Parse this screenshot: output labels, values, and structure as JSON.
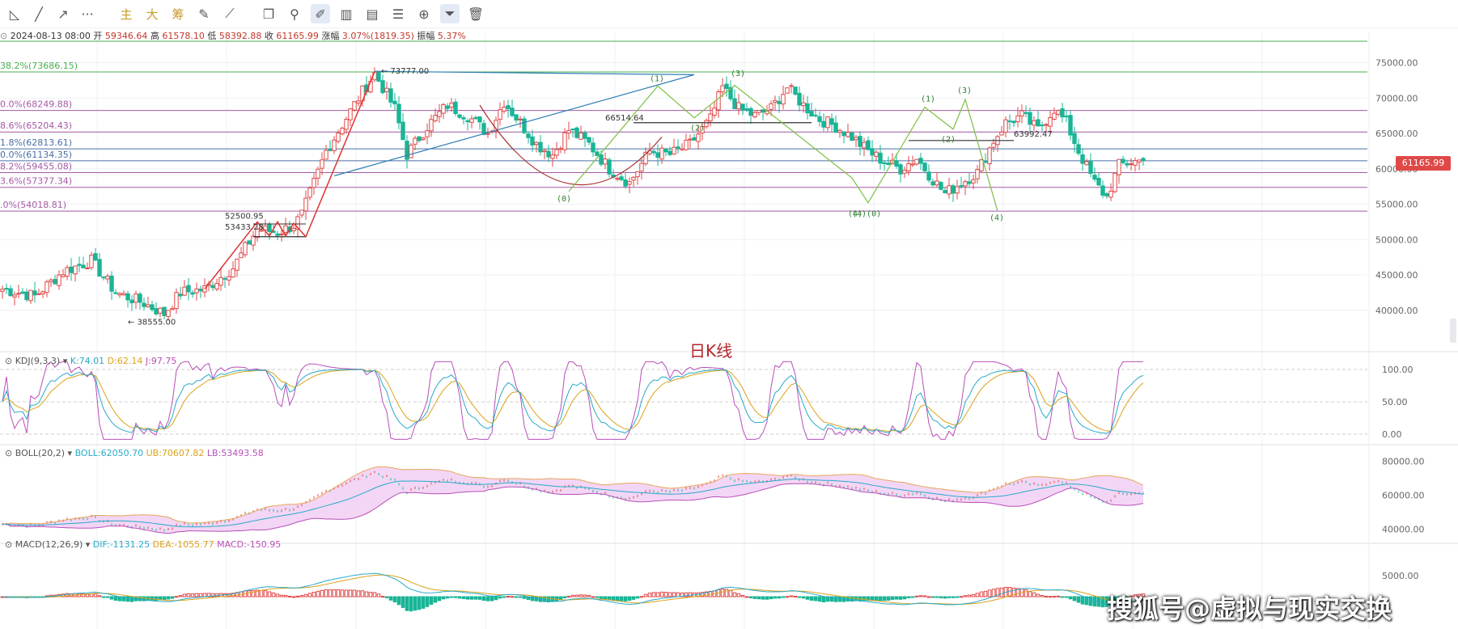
{
  "toolbar": {
    "items": [
      {
        "name": "line-segment-icon",
        "glyph": "◺"
      },
      {
        "name": "trend-line-icon",
        "glyph": "╱"
      },
      {
        "name": "ray-icon",
        "glyph": "↗"
      },
      {
        "name": "more-icon",
        "glyph": "···"
      },
      {
        "name": "main-indicator-button",
        "glyph": "主"
      },
      {
        "name": "large-order-button",
        "glyph": "大"
      },
      {
        "name": "chip-distribution-button",
        "glyph": "筹"
      },
      {
        "name": "edit-icon",
        "glyph": "✎"
      },
      {
        "name": "ruler-icon",
        "glyph": "⟋"
      },
      {
        "name": "copy-icon",
        "glyph": "❐"
      },
      {
        "name": "link-icon",
        "glyph": "⚲"
      },
      {
        "name": "draw-pen-icon",
        "glyph": "✐"
      },
      {
        "name": "candlestick-icon",
        "glyph": "▥"
      },
      {
        "name": "clipboard-icon",
        "glyph": "▤"
      },
      {
        "name": "note-icon",
        "glyph": "☰"
      },
      {
        "name": "pin-icon",
        "glyph": "⊕"
      },
      {
        "name": "filter-icon",
        "glyph": "⏷"
      },
      {
        "name": "trash-icon",
        "glyph": "🗑"
      }
    ]
  },
  "infobar": {
    "date": "2024-08-13 08:00",
    "open_label": "开",
    "open": "59346.64",
    "high_label": "高",
    "high": "61578.10",
    "low_label": "低",
    "low": "58392.88",
    "close_label": "收",
    "close": "61165.99",
    "change_label": "涨幅",
    "change": "3.07%(1819.35)",
    "amp_label": "振幅",
    "amp": "5.37%"
  },
  "chart_title": "日K线",
  "watermark": "搜狐号@虚拟与现实交换",
  "last_price": "61165.99",
  "colors": {
    "up": "#e04848",
    "down": "#19b596",
    "grid": "#eef0f3",
    "fib_green": "#4caf50",
    "fib_purple": "#a45aa4",
    "wave_green": "#7bc043",
    "trend_blue": "#2f7fb5"
  },
  "chart_data": [
    {
      "type": "candlestick",
      "name": "daily-kline",
      "title": "日K线",
      "ylim": [
        37000,
        77000
      ],
      "y_ticks": [
        "75000.00",
        "70000.00",
        "65000.00",
        "60000.00",
        "55000.00",
        "50000.00",
        "45000.00",
        "40000.00"
      ],
      "y_tick_values": [
        75000,
        70000,
        65000,
        60000,
        55000,
        50000,
        45000,
        40000
      ],
      "fib_levels": [
        {
          "label": "38.2%(73686.15)",
          "value": 73686.15,
          "color": "#4caf50"
        },
        {
          "label": "0.0%(68249.88)",
          "value": 68249.88,
          "color": "#a45aa4"
        },
        {
          "label": "8.6%(65204.43)",
          "value": 65204.43,
          "color": "#a45aa4"
        },
        {
          "label": "1.8%(62813.61)",
          "value": 62813.61,
          "color": "#4a6fa5"
        },
        {
          "label": "0.0%(61134.35)",
          "value": 61134.35,
          "color": "#4a6fa5"
        },
        {
          "label": "8.2%(59455.08)",
          "value": 59455.08,
          "color": "#a45aa4"
        },
        {
          "label": "3.6%(57377.34)",
          "value": 57377.34,
          "color": "#a45aa4"
        },
        {
          "label": ".0%(54018.81)",
          "value": 54018.81,
          "color": "#a45aa4"
        }
      ],
      "annotations": [
        "73777.00",
        "66514.64",
        "63992.47",
        "52500.95",
        "53433.28",
        "38555.00"
      ],
      "wave_labels": [
        "(1)",
        "(2)",
        "(3)",
        "(4)",
        "(0)",
        "(1)",
        "(2)",
        "(3)",
        "(4)",
        "(4)(0)"
      ],
      "ohlc_anchors": [
        [
          0,
          43000
        ],
        [
          8,
          42000
        ],
        [
          15,
          45500
        ],
        [
          22,
          47000
        ],
        [
          28,
          42500
        ],
        [
          35,
          41000
        ],
        [
          40,
          39500
        ],
        [
          44,
          42500
        ],
        [
          50,
          43000
        ],
        [
          57,
          46000
        ],
        [
          63,
          51500
        ],
        [
          68,
          51000
        ],
        [
          72,
          52000
        ],
        [
          74,
          53500
        ],
        [
          80,
          62500
        ],
        [
          88,
          70000
        ],
        [
          92,
          73500
        ],
        [
          97,
          68500
        ],
        [
          100,
          62000
        ],
        [
          105,
          66000
        ],
        [
          110,
          69000
        ],
        [
          115,
          67500
        ],
        [
          120,
          65000
        ],
        [
          124,
          69500
        ],
        [
          128,
          66500
        ],
        [
          132,
          63500
        ],
        [
          136,
          62000
        ],
        [
          140,
          65500
        ],
        [
          145,
          63500
        ],
        [
          150,
          60000
        ],
        [
          155,
          58000
        ],
        [
          160,
          62500
        ],
        [
          165,
          62000
        ],
        [
          170,
          63500
        ],
        [
          175,
          67000
        ],
        [
          178,
          71500
        ],
        [
          182,
          68500
        ],
        [
          186,
          67500
        ],
        [
          190,
          68500
        ],
        [
          194,
          71500
        ],
        [
          198,
          69000
        ],
        [
          202,
          67000
        ],
        [
          206,
          66000
        ],
        [
          210,
          64500
        ],
        [
          214,
          62500
        ],
        [
          218,
          61000
        ],
        [
          222,
          60000
        ],
        [
          226,
          61500
        ],
        [
          230,
          58500
        ],
        [
          233,
          56500
        ],
        [
          237,
          58000
        ],
        [
          241,
          59500
        ],
        [
          245,
          64000
        ],
        [
          248,
          66500
        ],
        [
          252,
          67500
        ],
        [
          256,
          65500
        ],
        [
          260,
          68500
        ],
        [
          263,
          66500
        ],
        [
          266,
          62500
        ],
        [
          270,
          58000
        ],
        [
          273,
          56000
        ],
        [
          276,
          60500
        ],
        [
          279,
          61000
        ],
        [
          282,
          61166
        ]
      ],
      "last_close": 61165.99
    },
    {
      "type": "line",
      "name": "KDJ(9,3,3)",
      "series_names": [
        "K",
        "D",
        "J"
      ],
      "series_values": [
        "74.01",
        "62.14",
        "97.75"
      ],
      "ylim": [
        -10,
        115
      ],
      "y_ticks": [
        "100.00",
        "50.00",
        "0.00"
      ],
      "y_tick_values": [
        100,
        50,
        0
      ]
    },
    {
      "type": "line",
      "name": "BOLL(20,2)",
      "series_names": [
        "BOLL",
        "UB",
        "LB"
      ],
      "series_values": [
        "62050.70",
        "70607.82",
        "53493.58"
      ],
      "ylim": [
        35000,
        85000
      ],
      "y_ticks": [
        "80000.00",
        "60000.00",
        "40000.00"
      ],
      "y_tick_values": [
        80000,
        60000,
        40000
      ]
    },
    {
      "type": "bar",
      "name": "MACD(12,26,9)",
      "series_names": [
        "DIF",
        "DEA",
        "MACD"
      ],
      "series_values": [
        "-1131.25",
        "-1055.77",
        "-150.95"
      ],
      "y_ticks": [
        "5000.00"
      ],
      "y_tick_values": [
        5000
      ]
    }
  ]
}
